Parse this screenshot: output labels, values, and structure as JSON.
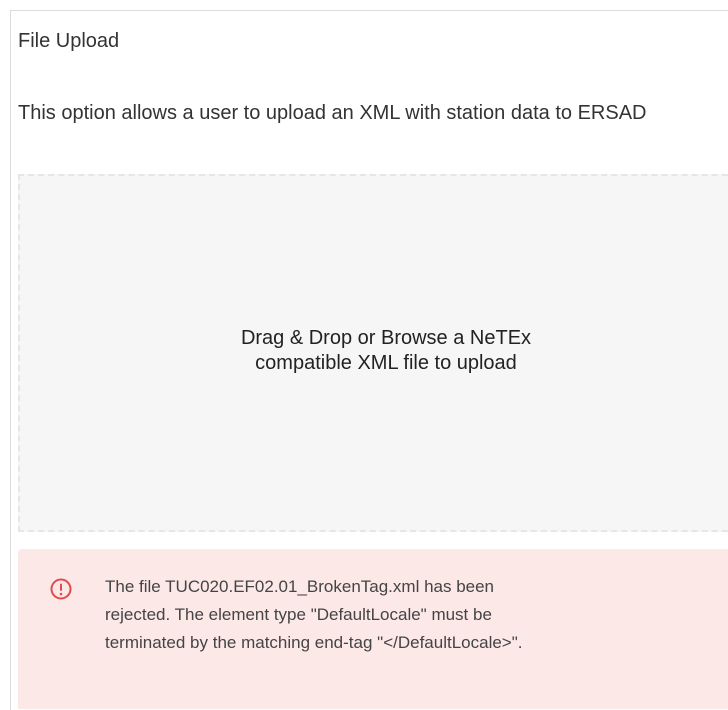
{
  "panel": {
    "title": "File Upload",
    "description": "This option allows a user to upload an XML with station data to ERSAD"
  },
  "dropzone": {
    "line1": "Drag & Drop or Browse a NeTEx",
    "line2": "compatible XML file to upload"
  },
  "alert": {
    "icon": "exclamation-circle-icon",
    "color": "#e04b4b",
    "background": "#fde8e8",
    "line1": "The file TUC020.EF02.01_BrokenTag.xml has been",
    "line2": "rejected. The element type \"DefaultLocale\" must be",
    "line3": "terminated by the matching end-tag \"</DefaultLocale>\"."
  }
}
